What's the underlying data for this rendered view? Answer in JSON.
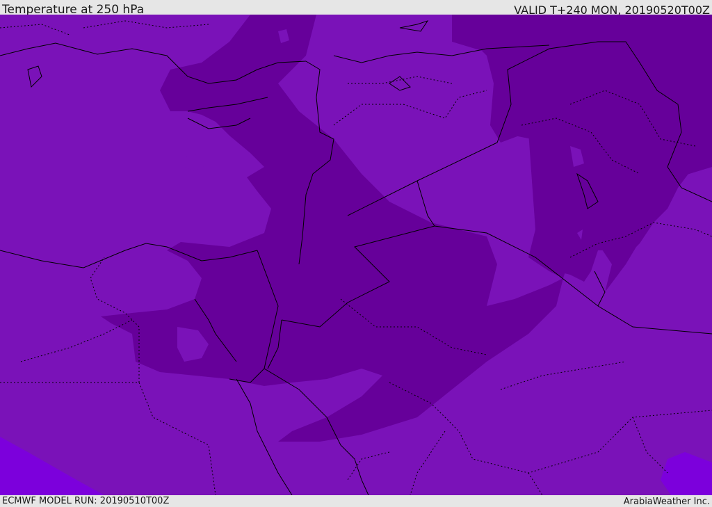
{
  "header": {
    "title": "Temperature at 250 hPa",
    "valid": "VALID T+240 MON, 20190520T00Z"
  },
  "footer": {
    "model_run": "ECMWF MODEL RUN: 20190510T00Z",
    "credit": "ArabiaWeather Inc."
  },
  "colors": {
    "background_band": "#7a12b8",
    "cold_band": "#66009a",
    "warm_band": "#7c00dc",
    "border_line": "#000000",
    "bar": "#e6e6e6"
  }
}
